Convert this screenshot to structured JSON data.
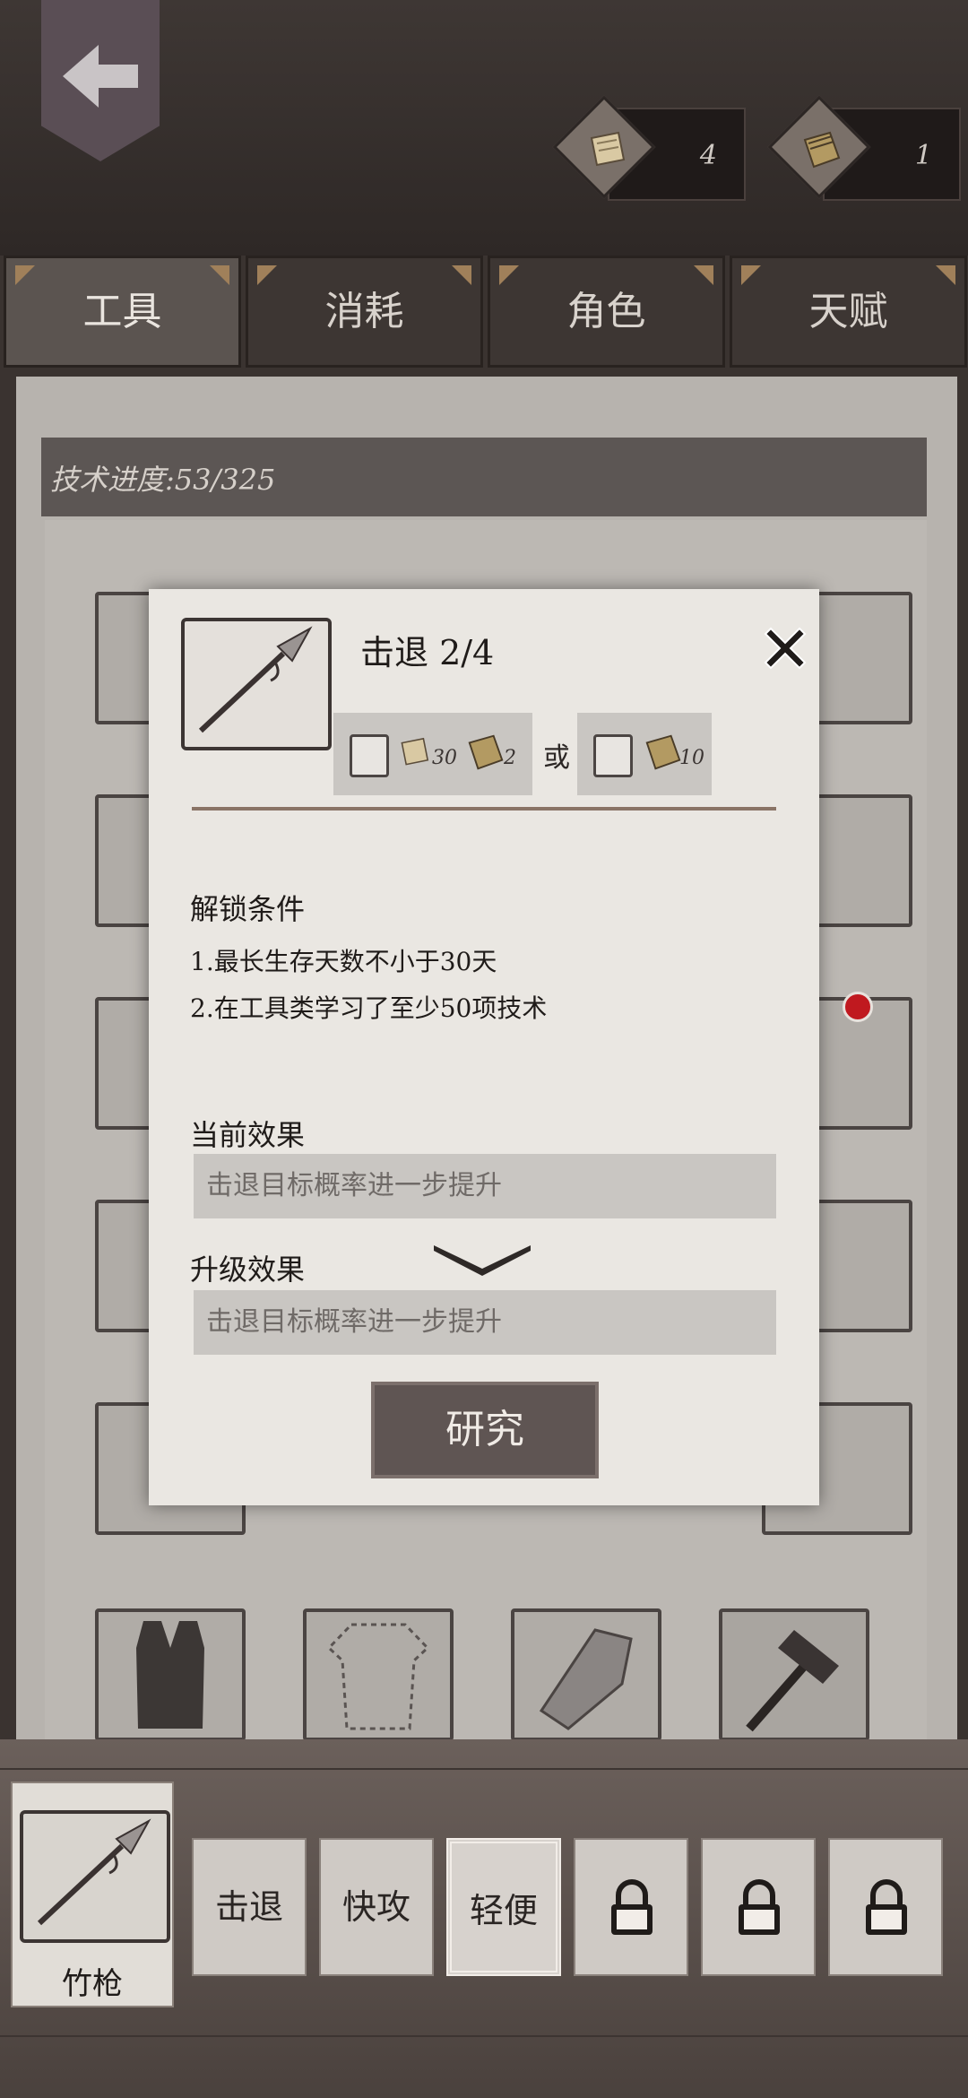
{
  "currencies": [
    {
      "icon": "scroll-icon",
      "count": "4"
    },
    {
      "icon": "book-icon",
      "count": "1"
    }
  ],
  "tabs": [
    {
      "label": "工具",
      "active": true
    },
    {
      "label": "消耗",
      "active": false
    },
    {
      "label": "角色",
      "active": false
    },
    {
      "label": "天赋",
      "active": false
    }
  ],
  "tech_progress": "技术进度:53/325",
  "modal": {
    "title": "击退 2/4",
    "cost_option_1": {
      "scroll_count": "30",
      "book_count": "2"
    },
    "or_label": "或",
    "cost_option_2": {
      "book_count": "10"
    },
    "unlock_heading": "解锁条件",
    "conditions": [
      "1.最长生存天数不小于30天",
      "2.在工具类学习了至少50项技术"
    ],
    "current_heading": "当前效果",
    "current_effect": "击退目标概率进一步提升",
    "upgrade_heading": "升级效果",
    "upgrade_effect": "击退目标概率进一步提升",
    "research_label": "研究"
  },
  "weapon": {
    "name": "竹枪"
  },
  "skills": [
    {
      "label": "击退",
      "locked": false,
      "selected": false
    },
    {
      "label": "快攻",
      "locked": false,
      "selected": false
    },
    {
      "label": "轻便",
      "locked": false,
      "selected": true
    },
    {
      "label": "",
      "locked": true
    },
    {
      "label": "",
      "locked": true
    },
    {
      "label": "",
      "locked": true
    }
  ],
  "colors": {
    "accent": "#a0805a",
    "notification": "#c0191f"
  }
}
